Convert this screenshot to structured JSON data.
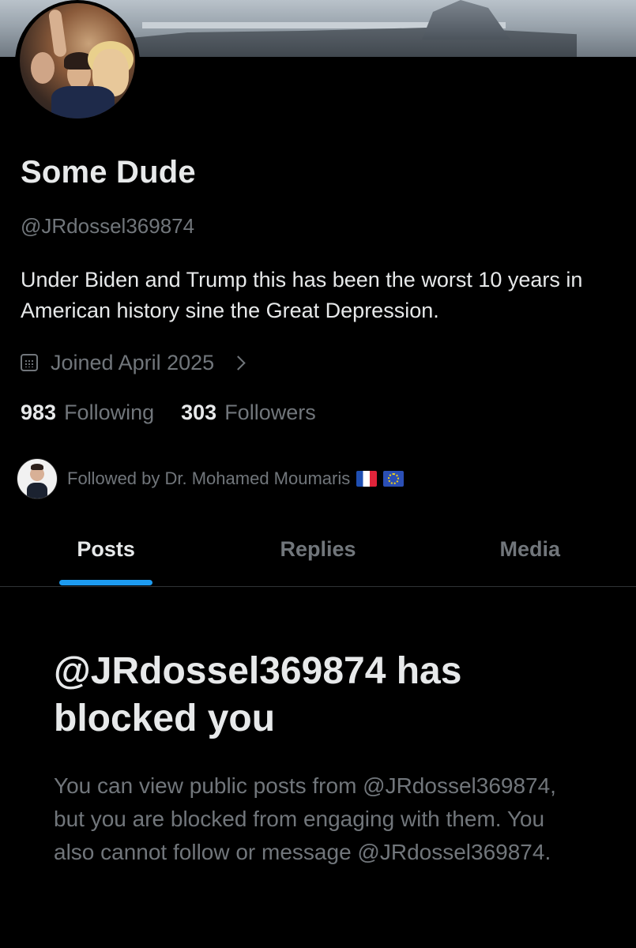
{
  "profile": {
    "name": "Some Dude",
    "handle": "@JRdossel369874",
    "bio": "Under Biden and Trump this has been the worst 10 years in American history sine the Great Depression.",
    "joined": "Joined April 2025",
    "following_count": "983",
    "following_label": "Following",
    "followers_count": "303",
    "followers_label": "Followers",
    "followed_by": "Followed by Dr. Mohamed Moumaris"
  },
  "tabs": [
    {
      "label": "Posts",
      "active": true
    },
    {
      "label": "Replies",
      "active": false
    },
    {
      "label": "Media",
      "active": false
    }
  ],
  "blocked": {
    "title": "@JRdossel369874 has blocked you",
    "body": "You can view public posts from @JRdossel369874, but you are blocked from engaging with them. You also cannot follow or message @JRdossel369874."
  },
  "icons": {
    "calendar": "calendar-icon",
    "chevron": "chevron-right-icon",
    "flags": [
      "flag-france-icon",
      "flag-eu-icon"
    ]
  },
  "colors": {
    "background": "#000000",
    "primary_text": "#e7e9ea",
    "secondary_text": "#71767b",
    "accent": "#1d9bf0",
    "divider": "#2f3336"
  }
}
